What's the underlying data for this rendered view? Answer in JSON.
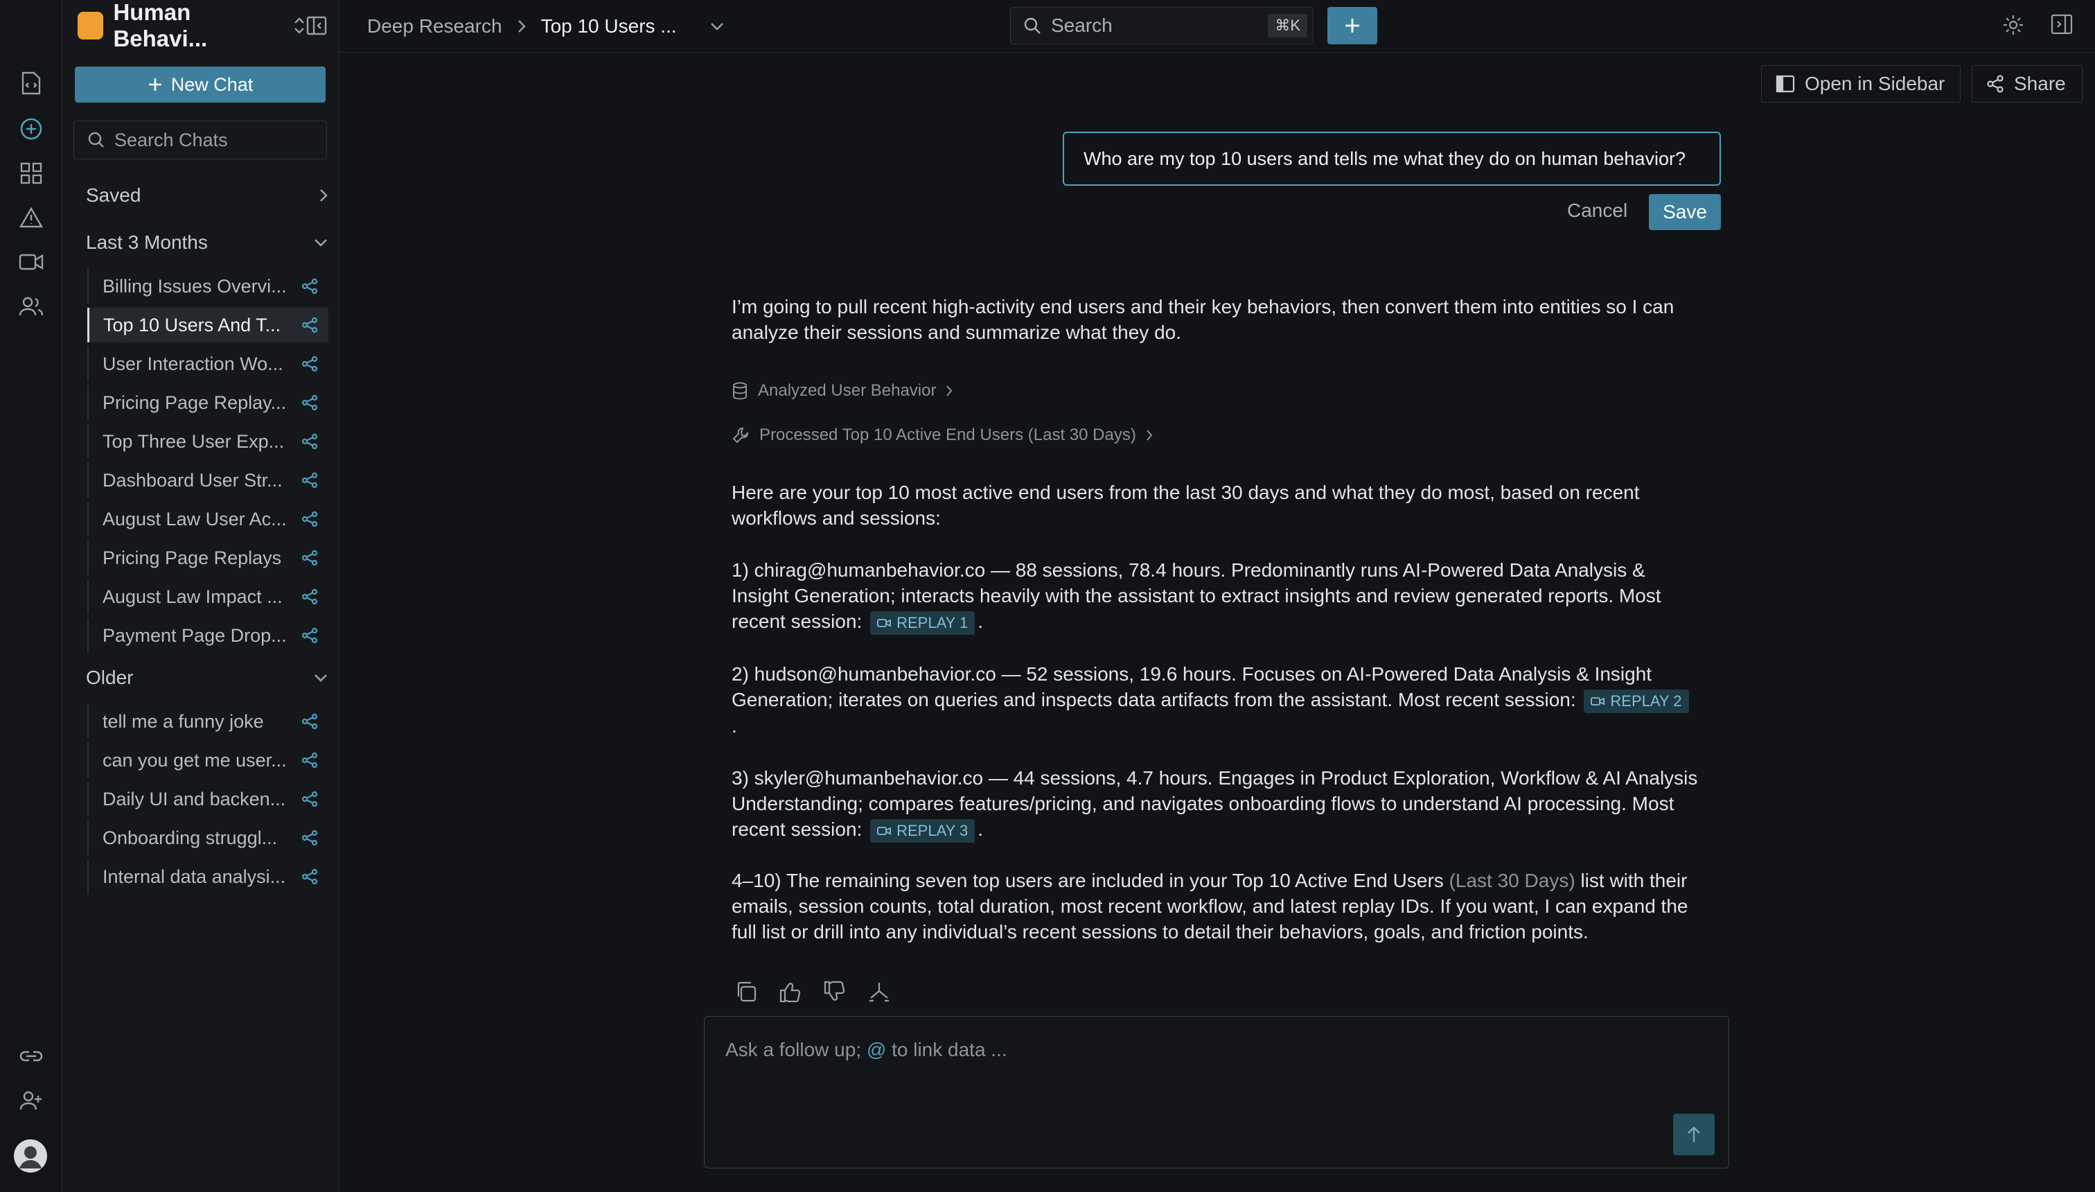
{
  "workspace": {
    "name": "Human Behavi..."
  },
  "sidebar": {
    "new_chat": "New Chat",
    "search_placeholder": "Search Chats",
    "saved": "Saved",
    "last3": "Last 3 Months",
    "older": "Older",
    "recent_items": [
      "Billing Issues Overvi...",
      "Top 10 Users And T...",
      "User Interaction Wo...",
      "Pricing Page Replay...",
      "Top Three User Exp...",
      "Dashboard User Str...",
      "August Law User Ac...",
      "Pricing Page Replays",
      "August Law Impact ...",
      "Payment Page Drop..."
    ],
    "older_items": [
      "tell me a funny joke",
      "can you get me user...",
      "Daily UI and backen...",
      "Onboarding struggl...",
      "Internal data analysi..."
    ]
  },
  "topbar": {
    "crumb1": "Deep Research",
    "crumb2": "Top 10 Users ...",
    "search": "Search",
    "shortcut": "⌘K"
  },
  "header": {
    "open_sidebar": "Open in Sidebar",
    "share": "Share"
  },
  "edit": {
    "value": "Who are my top 10 users and tells me what they do on human behavior?",
    "cancel": "Cancel",
    "save": "Save"
  },
  "message": {
    "intro": "I’m going to pull recent high-activity end users and their key behaviors, then convert them into entities so I can analyze their sessions and summarize what they do.",
    "tool1": "Analyzed User Behavior",
    "tool2": "Processed Top 10 Active End Users (Last 30 Days)",
    "summary": "Here are your top 10 most active end users from the last 30 days and what they do most, based on recent workflows and sessions:",
    "item1": "1) chirag@humanbehavior.co — 88 sessions, 78.4 hours. Predominantly runs AI-Powered Data Analysis & Insight Generation; interacts heavily with the assistant to extract insights and review generated reports. Most recent session:",
    "replay1": "REPLAY 1",
    "item2": "2) hudson@humanbehavior.co — 52 sessions, 19.6 hours. Focuses on AI-Powered Data Analysis & Insight Generation; iterates on queries and inspects data artifacts from the assistant. Most recent session:",
    "replay2": "REPLAY 2",
    "item3": "3) skyler@humanbehavior.co — 44 sessions, 4.7 hours. Engages in Product Exploration, Workflow & AI Analysis Understanding; compares features/pricing, and navigates onboarding flows to understand AI processing. Most recent session:",
    "replay3": "REPLAY 3",
    "item4_a": "4–10) The remaining seven top users are included in your Top 10 Active End Users",
    "item4_b": "(Last 30 Days)",
    "item4_c": "list with their emails, session counts, total duration, most recent workflow, and latest replay IDs. If you want, I can expand the full list or drill into any individual’s recent sessions to detail their behaviors, goals, and friction points.",
    "period": "."
  },
  "composer": {
    "ph_a": "Ask a follow up;",
    "ph_at": "@",
    "ph_b": "to link data ..."
  }
}
